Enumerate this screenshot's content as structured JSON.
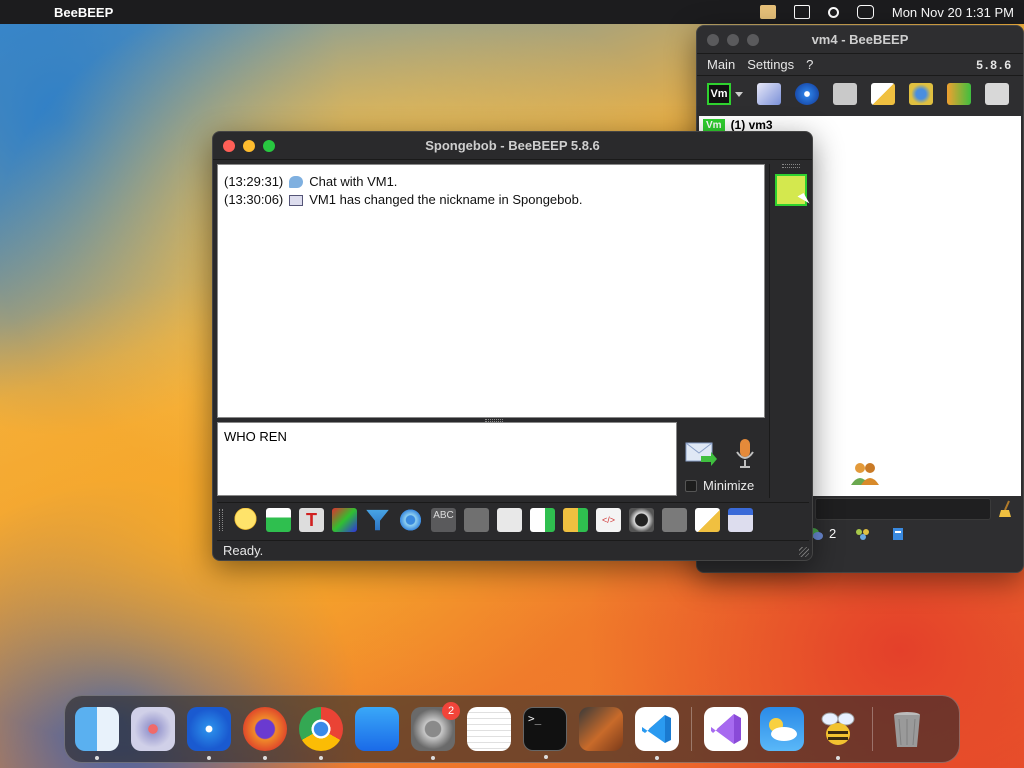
{
  "menubar": {
    "app_name": "BeeBEEP",
    "clock": "Mon Nov 20  1:31 PM"
  },
  "vm4_window": {
    "title": "vm4 - BeeBEEP",
    "menu": [
      "Main",
      "Settings",
      "?"
    ],
    "version": "5.8.6",
    "vm_badge": "Vm",
    "user_row": {
      "tag": "Vm",
      "label": "(1) vm3"
    },
    "status_count": "2"
  },
  "chat_window": {
    "title": "Spongebob - BeeBEEP 5.8.6",
    "messages": [
      {
        "time": "(13:29:31)",
        "icon": "chat-bubble-icon",
        "text": "Chat with VM1."
      },
      {
        "time": "(13:30:06)",
        "icon": "info-card-icon",
        "text": "VM1 has changed the nickname in Spongebob."
      }
    ],
    "compose_value": "WHO REN",
    "minimize_label": "Minimize",
    "status": "Ready."
  },
  "toolbar_icons": [
    "emoticon-icon",
    "mail-icon",
    "text-format-icon",
    "color-icon",
    "filter-icon",
    "settings-gears-icon",
    "spellcheck-icon",
    "font-icon",
    "document-icon",
    "export-icon",
    "folder-share-icon",
    "code-icon",
    "camera-icon",
    "screenshot-icon",
    "notes-icon",
    "save-icon"
  ],
  "dock": {
    "apps": [
      "Finder",
      "Launchpad",
      "Safari",
      "Firefox",
      "Chrome",
      "App Store",
      "System Settings",
      "TextEdit",
      "Terminal",
      "GarageBand",
      "VS Code",
      "Visual Studio",
      "Weather",
      "BeeBEEP",
      "Trash"
    ],
    "settings_badge": "2"
  },
  "colors": {
    "accent_green": "#2fd12f",
    "close": "#ff5f57",
    "minimize": "#febc2e",
    "zoom": "#28c840"
  }
}
